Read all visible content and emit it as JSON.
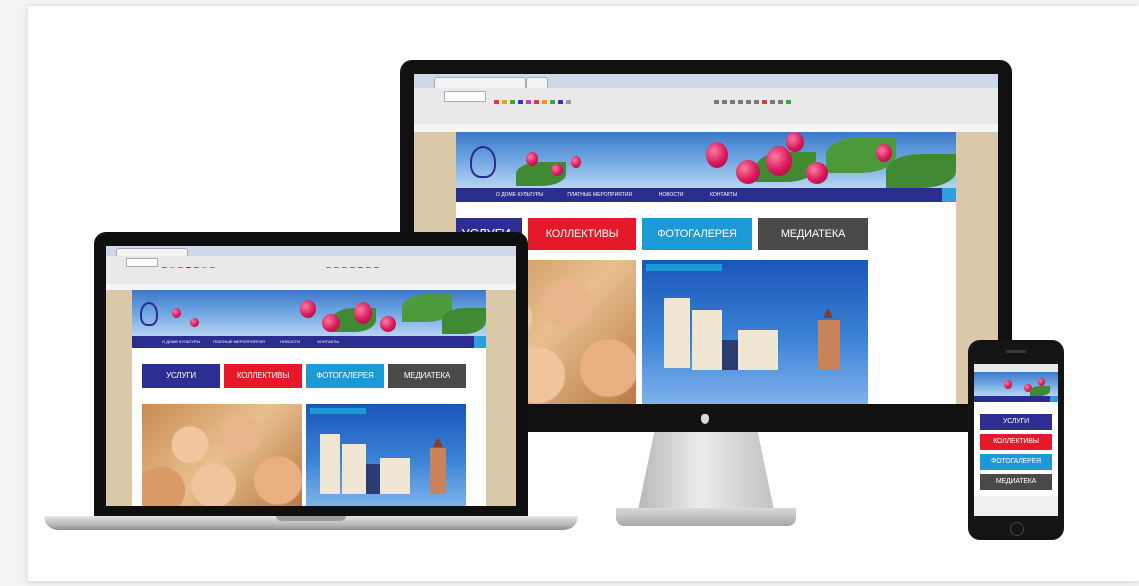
{
  "site": {
    "tiles": [
      "УСЛУГИ",
      "КОЛЛЕКТИВЫ",
      "ФОТОГАЛЕРЕЯ",
      "МЕДИАТЕКА"
    ],
    "nav_items": [
      "О ДОМЕ КУЛЬТУРЫ",
      "ПЛАТНЫЕ МЕРОПРИЯТИЯ",
      "НОВОСТИ",
      "КОНТАКТЫ"
    ]
  },
  "colors": {
    "tile_blue": "#2d2d92",
    "tile_red": "#e5192a",
    "tile_cyan": "#1b9ad6",
    "tile_gray": "#4a4a4a",
    "nav": "#2b2c8f"
  },
  "icons": {
    "monitor_logo": "apple-logo-icon",
    "search": "search-icon"
  }
}
